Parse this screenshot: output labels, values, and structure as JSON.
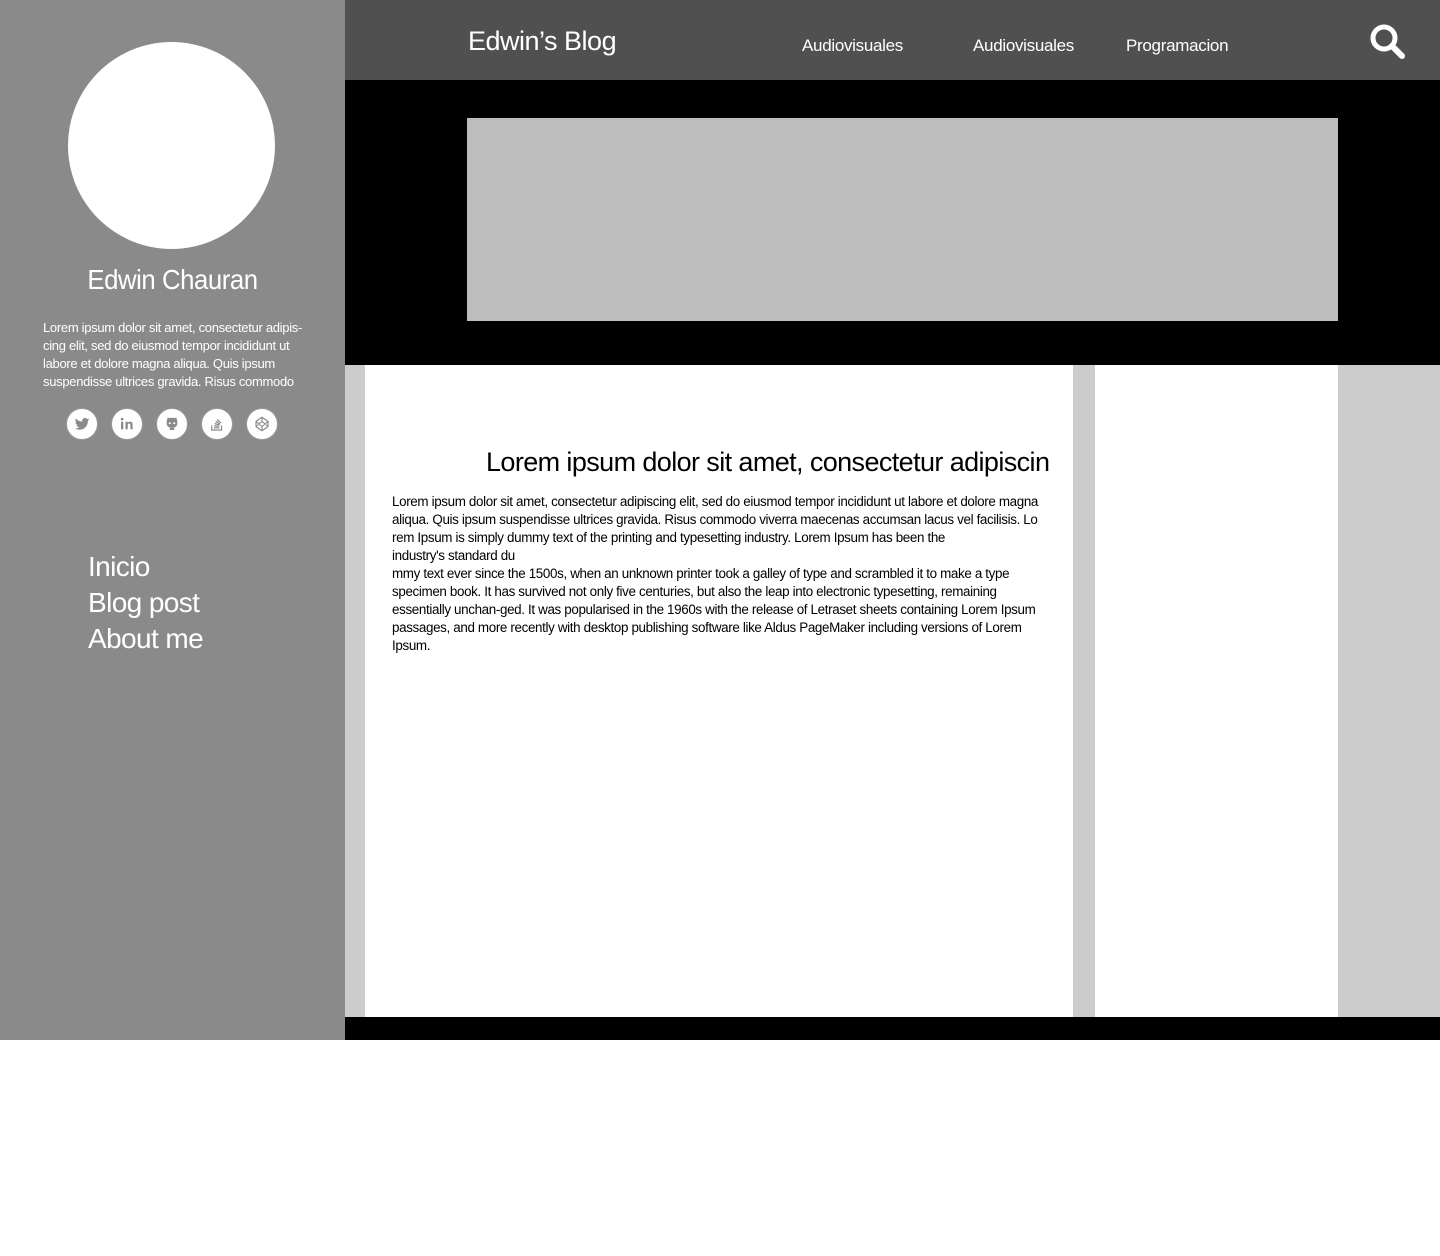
{
  "sidebar": {
    "author_name": "Edwin Chauran",
    "bio": "Lorem ipsum dolor sit amet, consectetur adipis-cing elit, sed do eiusmod tempor incididunt ut labore et dolore magna aliqua. Quis ipsum suspendisse ultrices gravida. Risus commodo",
    "socials": [
      {
        "icon": "twitter-icon"
      },
      {
        "icon": "linkedin-icon"
      },
      {
        "icon": "github-icon"
      },
      {
        "icon": "stackoverflow-icon"
      },
      {
        "icon": "codepen-icon"
      }
    ],
    "nav": [
      "Inicio",
      "Blog post",
      "About me"
    ]
  },
  "header": {
    "title": "Edwin’s Blog",
    "nav": [
      "Audiovisuales",
      "Audiovisuales",
      "Programacion"
    ],
    "search_icon": "search-icon"
  },
  "article": {
    "title": "Lorem ipsum dolor sit amet, consectetur adipiscin",
    "paragraphs": [
      "Lorem ipsum dolor sit amet, consectetur adipiscing elit, sed do eiusmod tempor incididunt ut labore et dolore magna aliqua. Quis ipsum suspendisse ultrices gravida. Risus commodo viverra maecenas accumsan lacus vel facilisis. Lo",
      "rem Ipsum is simply dummy text of the printing and typesetting industry. Lorem Ipsum has been the",
      "industry's standard du",
      "mmy text ever since the 1500s, when an unknown printer took a galley of type and scrambled it to make a type specimen book. It has survived not only five centuries, but also the leap into electronic typesetting, remaining essentially unchan-ged. It was popularised in the 1960s with the release of Letraset sheets containing Lorem Ipsum passages, and more recently with desktop publishing software like Aldus PageMaker including versions of Lorem Ipsum."
    ]
  },
  "colors": {
    "sidebar": "#8a8a8a",
    "topbar": "#505050",
    "hero": "#000000",
    "hero_image": "#bdbdbd",
    "content_bg": "#cccccc"
  }
}
